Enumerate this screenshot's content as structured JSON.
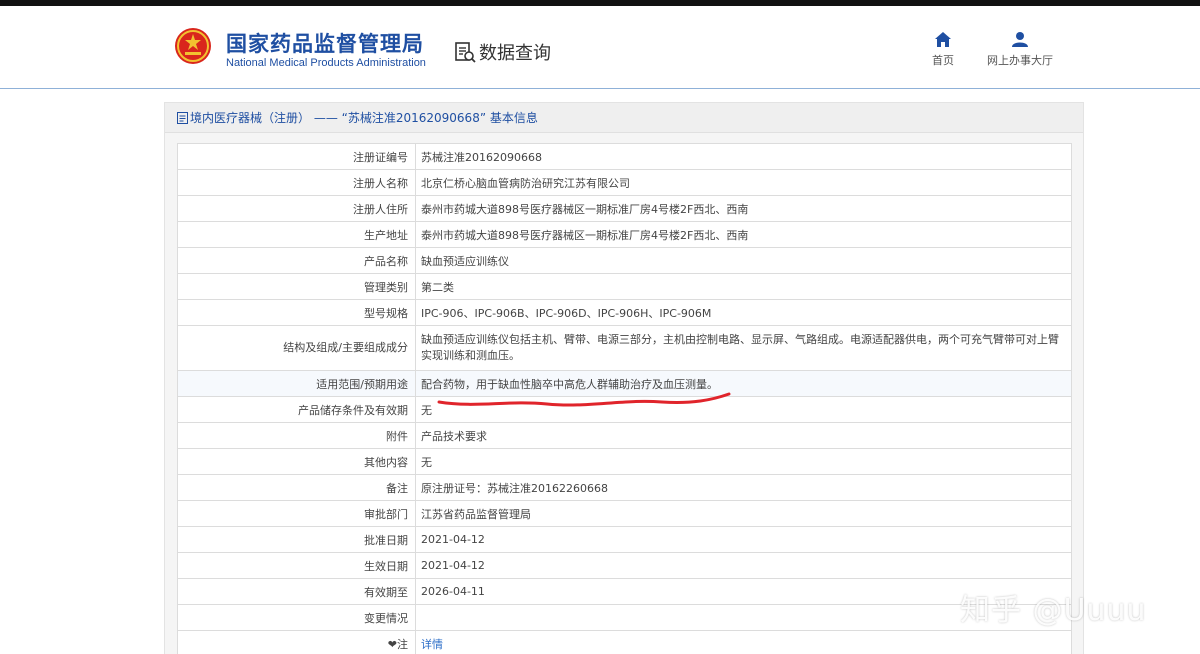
{
  "header": {
    "brand_cn": "国家药品监督管理局",
    "brand_en": "National Medical Products Administration",
    "query_label": "数据查询",
    "nav": {
      "home": "首页",
      "hall": "网上办事大厅"
    }
  },
  "panel": {
    "title": "境内医疗器械（注册） —— “苏械注准20162090668” 基本信息"
  },
  "rows": [
    {
      "label": "注册证编号",
      "value": "苏械注准20162090668"
    },
    {
      "label": "注册人名称",
      "value": "北京仁桥心脑血管病防治研究江苏有限公司"
    },
    {
      "label": "注册人住所",
      "value": "泰州市药城大道898号医疗器械区一期标准厂房4号楼2F西北、西南"
    },
    {
      "label": "生产地址",
      "value": "泰州市药城大道898号医疗器械区一期标准厂房4号楼2F西北、西南"
    },
    {
      "label": "产品名称",
      "value": "缺血预适应训练仪"
    },
    {
      "label": "管理类别",
      "value": "第二类"
    },
    {
      "label": "型号规格",
      "value": "IPC-906、IPC-906B、IPC-906D、IPC-906H、IPC-906M"
    },
    {
      "label": "结构及组成/主要组成成分",
      "value": "缺血预适应训练仪包括主机、臂带、电源三部分，主机由控制电路、显示屏、气路组成。电源适配器供电，两个可充气臂带可对上臂实现训练和测血压。"
    },
    {
      "label": "适用范围/预期用途",
      "value": "配合药物，用于缺血性脑卒中高危人群辅助治疗及血压测量。"
    },
    {
      "label": "产品储存条件及有效期",
      "value": "无"
    },
    {
      "label": "附件",
      "value": "产品技术要求"
    },
    {
      "label": "其他内容",
      "value": "无"
    },
    {
      "label": "备注",
      "value": "原注册证号：苏械注准20162260668"
    },
    {
      "label": "审批部门",
      "value": "江苏省药品监督管理局"
    },
    {
      "label": "批准日期",
      "value": "2021-04-12"
    },
    {
      "label": "生效日期",
      "value": "2021-04-12"
    },
    {
      "label": "有效期至",
      "value": "2026-04-11"
    },
    {
      "label": "变更情况",
      "value": ""
    },
    {
      "label": "注",
      "value": "详情"
    }
  ],
  "watermark": "知乎 @Uuuu",
  "colors": {
    "brand_blue": "#1f4fa2",
    "link_blue": "#2a6cc7",
    "annotation_red": "#e0242b"
  }
}
